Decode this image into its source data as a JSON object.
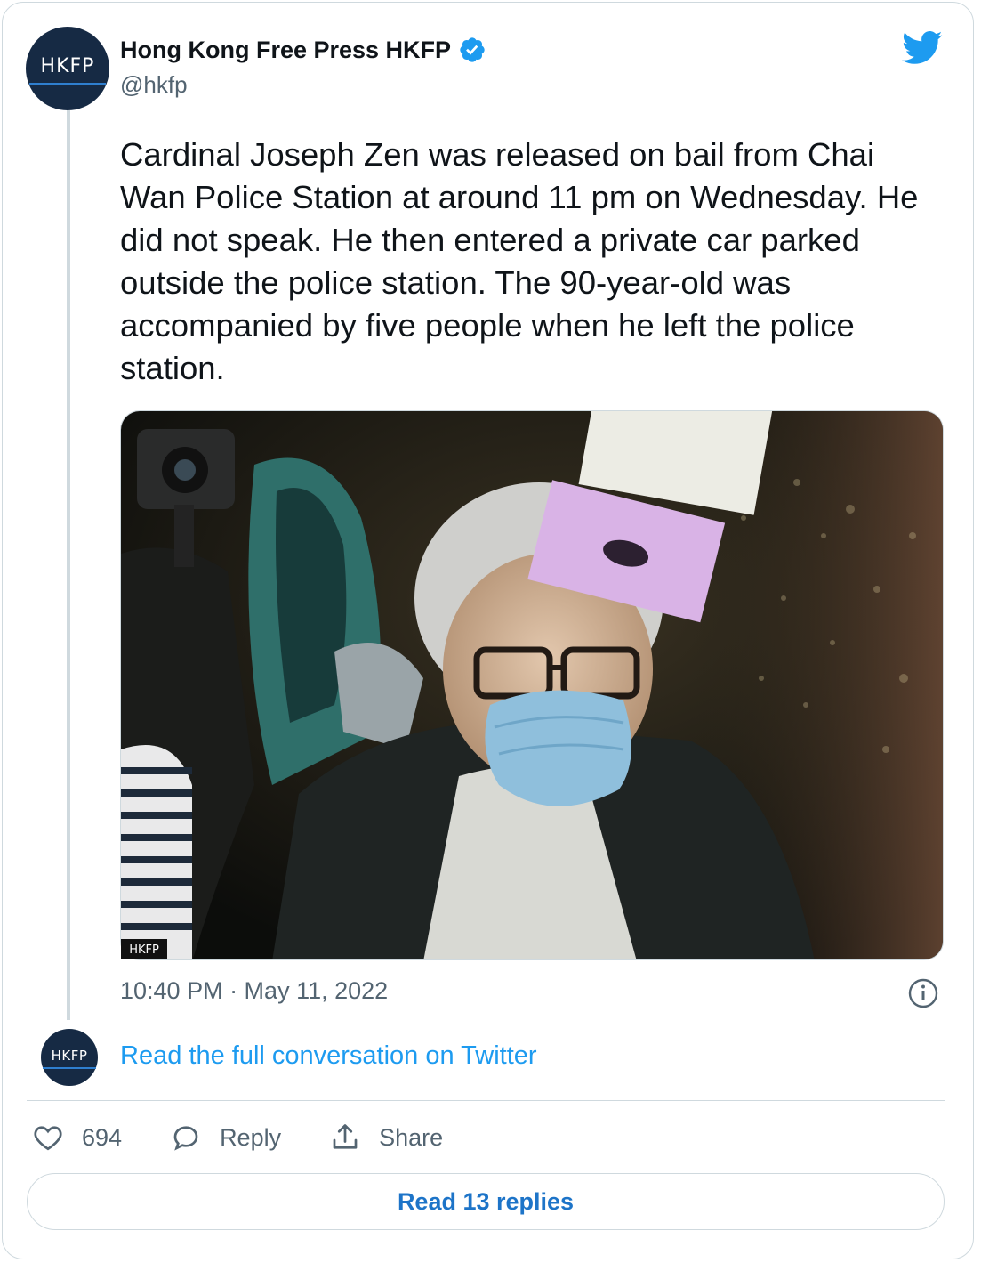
{
  "author": {
    "name": "Hong Kong Free Press HKFP",
    "handle": "@hkfp",
    "avatar_text": "HKFP",
    "verified": true
  },
  "tweet": {
    "text": "Cardinal Joseph Zen was released on bail from Chai Wan Police Station at around 11 pm on Wednesday. He did not speak. He then entered a private car parked outside the police station. The 90-year-old was accompanied by five people when he left the police station.",
    "timestamp": "10:40 PM · May 11, 2022",
    "photo_watermark": "HKFP"
  },
  "conversation": {
    "link_text": "Read the full conversation on Twitter",
    "avatar_text": "HKFP"
  },
  "actions": {
    "likes": "694",
    "reply_label": "Reply",
    "share_label": "Share"
  },
  "read_replies_label": "Read 13 replies",
  "colors": {
    "accent": "#1d9bf0",
    "verified": "#1d9bf0",
    "avatar_bg": "#162a44"
  },
  "icons": [
    "verified-badge-icon",
    "twitter-bird-icon",
    "info-icon",
    "heart-icon",
    "reply-bubble-icon",
    "share-icon"
  ]
}
